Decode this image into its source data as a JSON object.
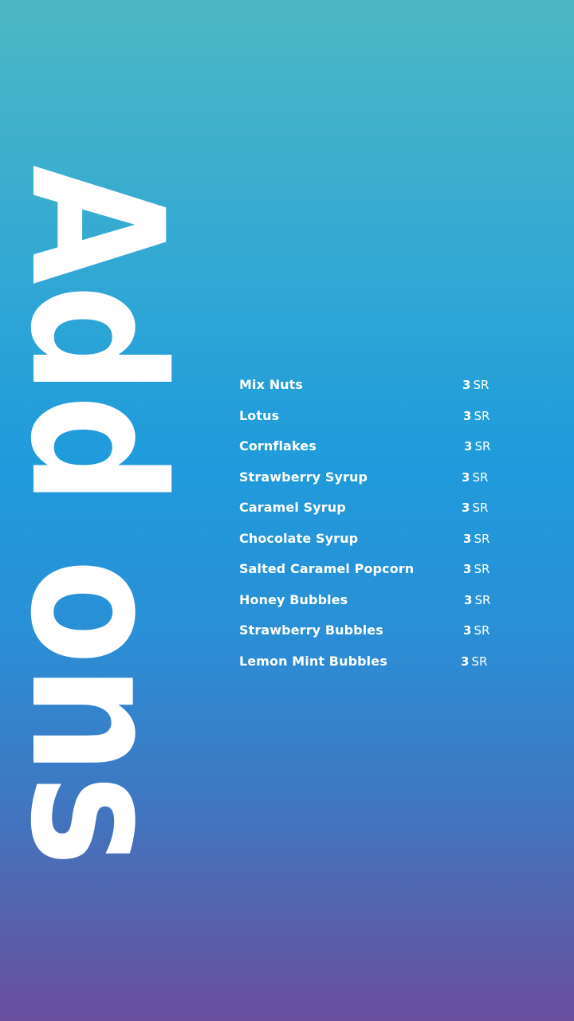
{
  "title": "Add ons",
  "menu": {
    "items": [
      {
        "name": "Mix Nuts",
        "price": "3",
        "currency": "SR"
      },
      {
        "name": "Lotus",
        "price": "3",
        "currency": "SR"
      },
      {
        "name": "Cornflakes",
        "price": "3",
        "currency": "SR"
      },
      {
        "name": "Strawberry Syrup",
        "price": "3",
        "currency": "SR"
      },
      {
        "name": "Caramel Syrup",
        "price": "3",
        "currency": "SR"
      },
      {
        "name": "Chocolate Syrup",
        "price": "3",
        "currency": "SR"
      },
      {
        "name": "Salted Caramel Popcorn",
        "price": "3",
        "currency": "SR"
      },
      {
        "name": "Honey Bubbles",
        "price": "3",
        "currency": "SR"
      },
      {
        "name": "Strawberry Bubbles",
        "price": "3",
        "currency": "SR"
      },
      {
        "name": "Lemon Mint Bubbles",
        "price": "3",
        "currency": "SR"
      }
    ]
  }
}
